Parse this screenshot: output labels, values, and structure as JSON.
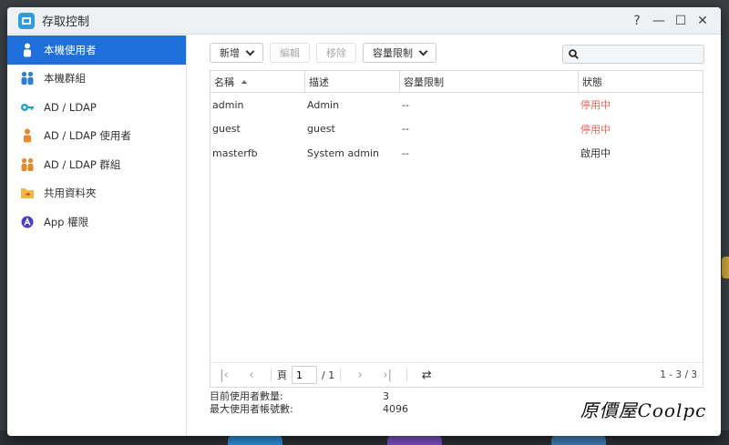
{
  "window": {
    "title": "存取控制"
  },
  "window_controls": [
    "?",
    "—",
    "☐",
    "✕"
  ],
  "sidebar": {
    "items": [
      {
        "label": "本機使用者",
        "icon": "user-icon",
        "active": true
      },
      {
        "label": "本機群組",
        "icon": "group-icon",
        "active": false
      },
      {
        "label": "AD / LDAP",
        "icon": "key-icon",
        "active": false
      },
      {
        "label": "AD / LDAP 使用者",
        "icon": "ad-user-icon",
        "active": false
      },
      {
        "label": "AD / LDAP 群組",
        "icon": "ad-group-icon",
        "active": false
      },
      {
        "label": "共用資料夾",
        "icon": "folder-icon",
        "active": false
      },
      {
        "label": "App 權限",
        "icon": "app-icon",
        "active": false
      }
    ]
  },
  "toolbar": {
    "add_label": "新增",
    "edit_label": "編輯",
    "remove_label": "移除",
    "quota_label": "容量限制",
    "search_placeholder": ""
  },
  "table": {
    "columns": [
      "名稱",
      "描述",
      "容量限制",
      "狀態"
    ],
    "rows": [
      {
        "name": "admin",
        "desc": "Admin",
        "quota": "--",
        "status": "停用中",
        "state": "off"
      },
      {
        "name": "guest",
        "desc": "guest",
        "quota": "--",
        "status": "停用中",
        "state": "off"
      },
      {
        "name": "masterfb",
        "desc": "System admin",
        "quota": "--",
        "status": "啟用中",
        "state": "on"
      }
    ]
  },
  "pager": {
    "page_label": "頁",
    "page_value": "1",
    "total_pages": "/ 1",
    "range": "1 - 3 / 3"
  },
  "stats": {
    "current_label": "目前使用者數量:",
    "current_value": "3",
    "max_label": "最大使用者帳號數:",
    "max_value": "4096"
  },
  "watermark": {
    "text": "原價屋Coolpc"
  },
  "colors": {
    "accent": "#1e6fd9",
    "status_off": "#e8665a",
    "app_icon": "#2f9be0"
  }
}
